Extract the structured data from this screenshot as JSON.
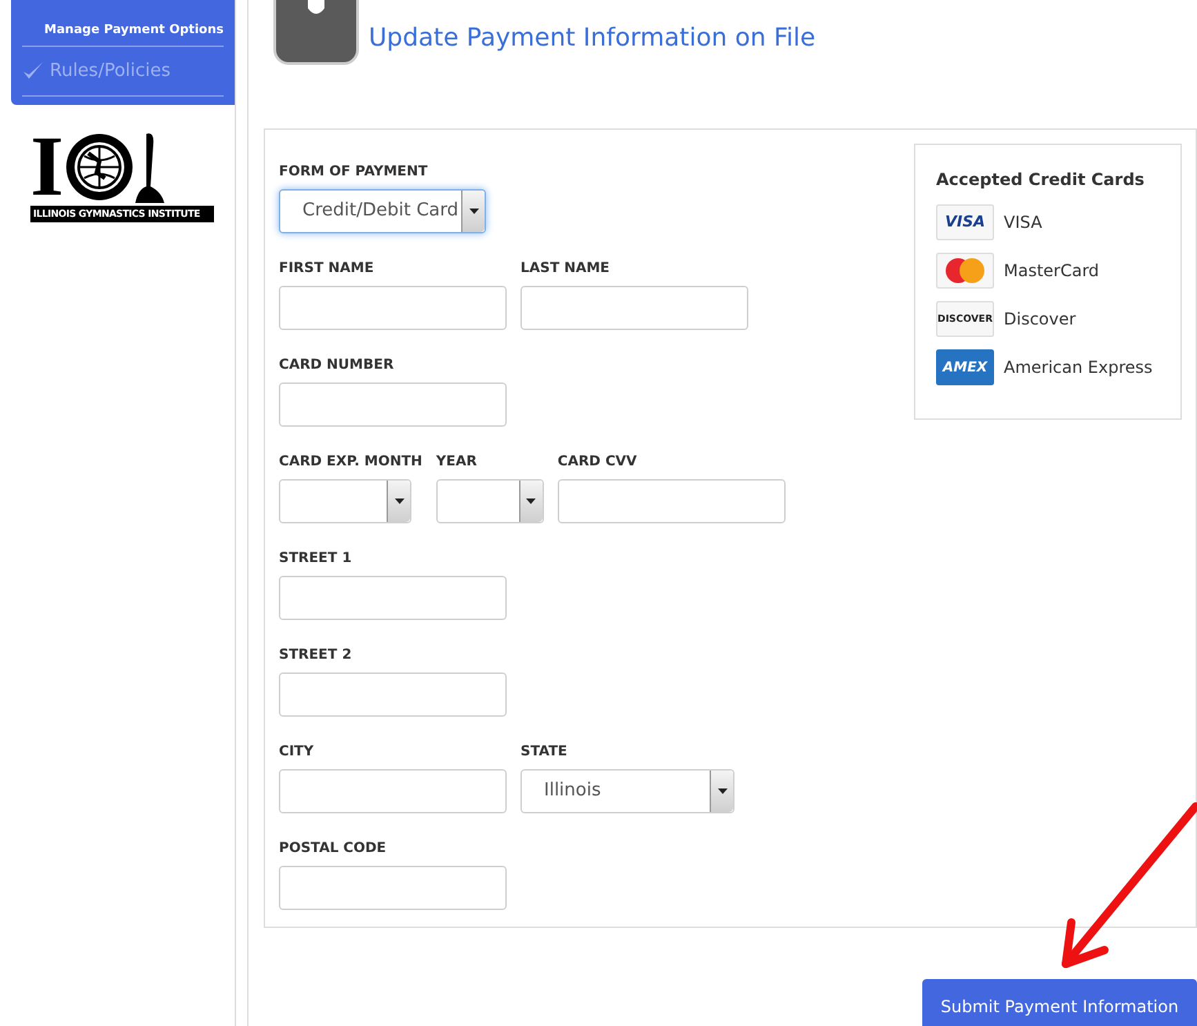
{
  "sidebar": {
    "items": [
      {
        "kind": "heading",
        "label": "Manage Payment Options"
      },
      {
        "kind": "link",
        "label": "Rules/Policies"
      }
    ]
  },
  "logo": {
    "letter": "I",
    "banner": "ILLINOIS GYMNASTICS INSTITUTE"
  },
  "page_title": "Update Payment Information on File",
  "form": {
    "rows": [
      [
        {
          "label": "FORM OF PAYMENT",
          "kind": "select",
          "value": "Credit/Debit Card",
          "focused": true
        }
      ],
      [
        {
          "label": "FIRST NAME",
          "kind": "text",
          "focused": false
        },
        {
          "label": "LAST NAME",
          "kind": "text",
          "focused": false
        }
      ],
      [
        {
          "label": "CARD NUMBER",
          "kind": "text",
          "focused": false
        }
      ],
      [
        {
          "label": "CARD EXP. MONTH",
          "kind": "select",
          "focused": false
        },
        {
          "label": "YEAR",
          "kind": "select",
          "focused": false
        },
        {
          "label": "CARD CVV",
          "kind": "text",
          "focused": false
        }
      ],
      [
        {
          "label": "STREET 1",
          "kind": "text",
          "focused": false
        }
      ],
      [
        {
          "label": "STREET 2",
          "kind": "text",
          "focused": false
        }
      ],
      [
        {
          "label": "CITY",
          "kind": "text",
          "focused": false
        },
        {
          "label": "STATE",
          "kind": "select",
          "value": "Illinois",
          "focused": false
        }
      ],
      [
        {
          "label": "POSTAL CODE",
          "kind": "text",
          "focused": false
        }
      ]
    ]
  },
  "accepted_cards": {
    "title": "Accepted Credit Cards",
    "cards": [
      {
        "kind": "visa",
        "badge": "VISA",
        "name": "VISA"
      },
      {
        "kind": "mastercard",
        "name": "MasterCard"
      },
      {
        "kind": "discover",
        "badge": "DISCOVER",
        "name": "Discover"
      },
      {
        "kind": "amex",
        "badge": "AMEX",
        "name": "American Express"
      }
    ]
  },
  "submit_button": "Submit Payment Information"
}
